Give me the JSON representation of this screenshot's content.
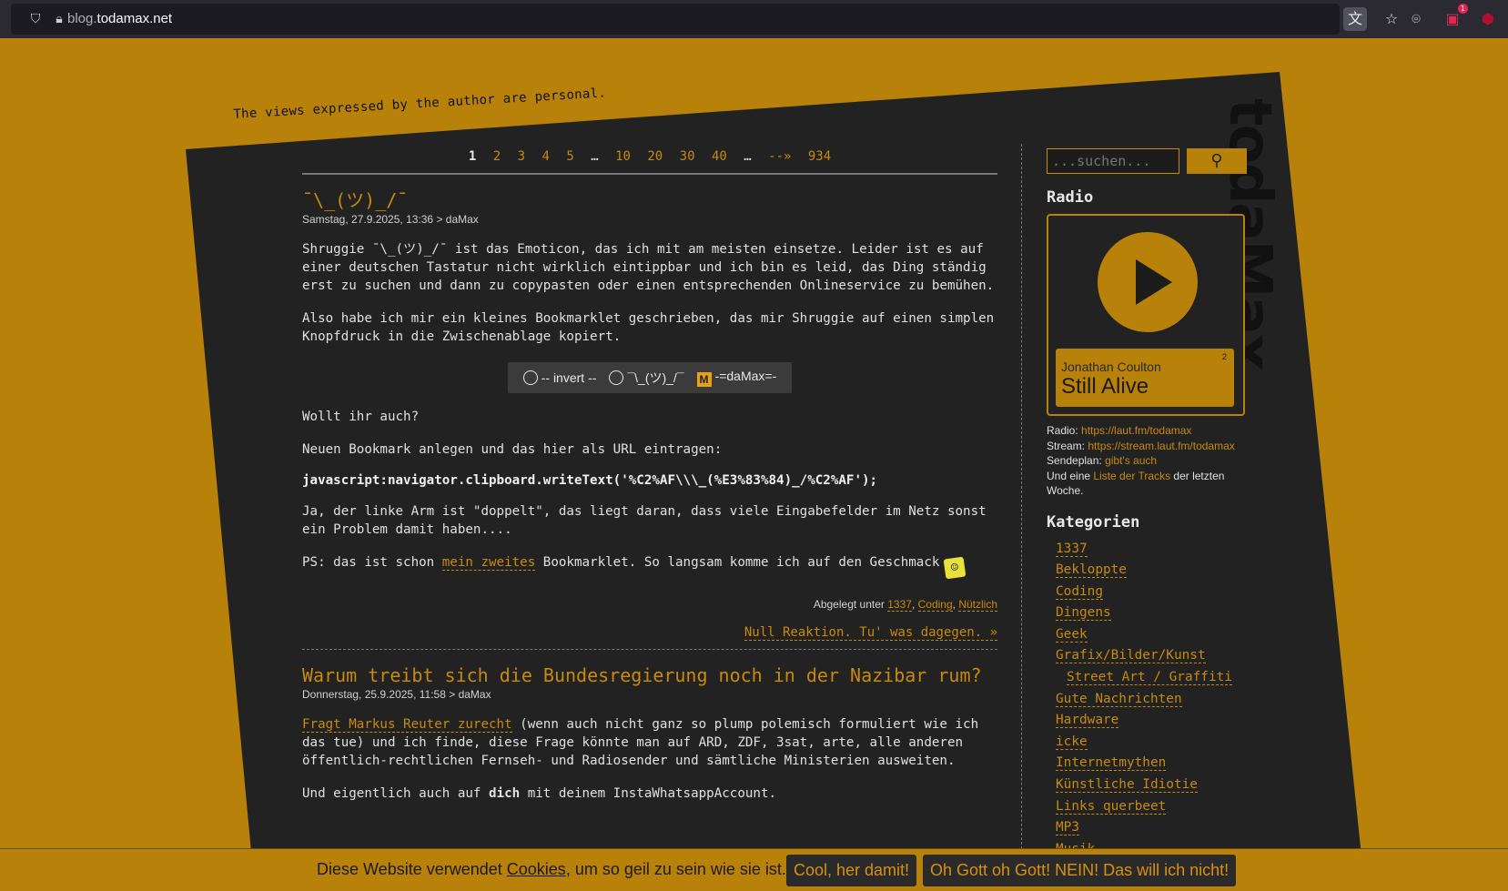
{
  "browser": {
    "url_sub": "blog.",
    "url_domain": "todamax.net",
    "ext_badge": "1"
  },
  "site": {
    "tagline": "The views expressed by the author are personal.",
    "logo": "todaMax"
  },
  "pager": {
    "current": "1",
    "pages": [
      "2",
      "3",
      "4",
      "5"
    ],
    "ellipsis1": "…",
    "tens": [
      "10",
      "20",
      "30",
      "40"
    ],
    "ellipsis2": "…",
    "next": "--»",
    "last": "934"
  },
  "post1": {
    "title": "¯\\_(ツ)_/¯",
    "meta": "Samstag, 27.9.2025, 13:36 > daMax",
    "p1": "Shruggie ¯\\_(ツ)_/¯ ist das Emoticon, das ich mit am meisten einsetze. Leider ist es auf einer deutschen Tastatur nicht wirklich eintippbar und ich bin es leid, das Ding ständig erst zu suchen und dann zu copypasten oder einen entsprechenden Onlineservice zu bemühen.",
    "p2": "Also habe ich mir ein kleines Bookmarklet geschrieben, das mir Shruggie auf einen sim­plen Knopfdruck in die Zwischenablage kopiert.",
    "bookmarks": [
      "-- invert --",
      "¯\\_(ツ)_/¯",
      "-=daMax=-"
    ],
    "p3": "Wollt ihr auch?",
    "p4": "Neuen Bookmark anlegen und das hier als URL eintragen:",
    "code": "javascript:navigator.clipboard.writeText('%C2%AF\\\\\\_(%E3%83%84)_/%C2%AF');",
    "p5": "Ja, der linke Arm ist \"doppelt\", das liegt daran, dass viele Eingabefelder im Netz sonst ein Problem damit haben....",
    "p6_pre": "PS: das ist schon ",
    "p6_link": "mein zweites",
    "p6_post": " Bookmarklet. So langsam komme ich auf den Geschmack",
    "filed_label": "Abgelegt unter ",
    "filed_tags": [
      "1337",
      "Coding",
      "Nützlich"
    ],
    "reactions": "Null Reaktion. Tu' was dagegen. »"
  },
  "post2": {
    "title": "Warum treibt sich die Bundesregierung noch in der Nazibar rum?",
    "meta": "Donnerstag, 25.9.2025, 11:58 > daMax",
    "p1_link": "Fragt Markus Reuter zurecht",
    "p1_rest": " (wenn auch nicht ganz so plump polemisch formuliert wie ich das tue) und ich finde, diese Frage könnte man auf ARD, ZDF, 3sat, arte, alle anderen öffentlich-rechtlichen Fernseh- und Radiosender und sämtliche Ministerien ausweiten.",
    "p2_pre": "Und eigentlich auch auf ",
    "p2_bold": "dich",
    "p2_post": " mit deinem InstaWhatsappAccount."
  },
  "sidebar": {
    "search_placeholder": "...suchen...",
    "radio_heading": "Radio",
    "artist": "Jonathan Coulton",
    "track": "Still Alive",
    "queue_num": "2",
    "radio_label": "Radio: ",
    "radio_url": "https://laut.fm/todamax",
    "stream_label": "Stream: ",
    "stream_url": "https://stream.laut.fm/todamax",
    "schedule_label": "Sendeplan: ",
    "schedule_link": "gibt's auch",
    "tracks_pre": "Und eine ",
    "tracks_link": "Liste der Tracks",
    "tracks_post": " der letzten Woche.",
    "cat_heading": "Kategorien",
    "categories": [
      "1337",
      "Bekloppte",
      "Coding",
      "Dingens",
      "Geek",
      "Grafix/Bilder/Kunst",
      "Street Art / Graffiti",
      "Gute Nachrichten",
      "Hardware",
      "icke",
      "Internetmythen",
      "Künstliche Idiotie",
      "Links querbeet",
      "MP3",
      "Musik"
    ]
  },
  "cookie": {
    "msg_pre": "Diese Website verwendet ",
    "msg_link": "Cookies",
    "msg_post": ", um so geil zu sein wie sie ist.",
    "accept": "Cool, her damit!",
    "decline": "Oh Gott oh Gott! NEIN! Das will ich nicht!"
  },
  "colors": {
    "accent": "#b8810a",
    "panel": "#222222",
    "link": "#c88a0c"
  }
}
